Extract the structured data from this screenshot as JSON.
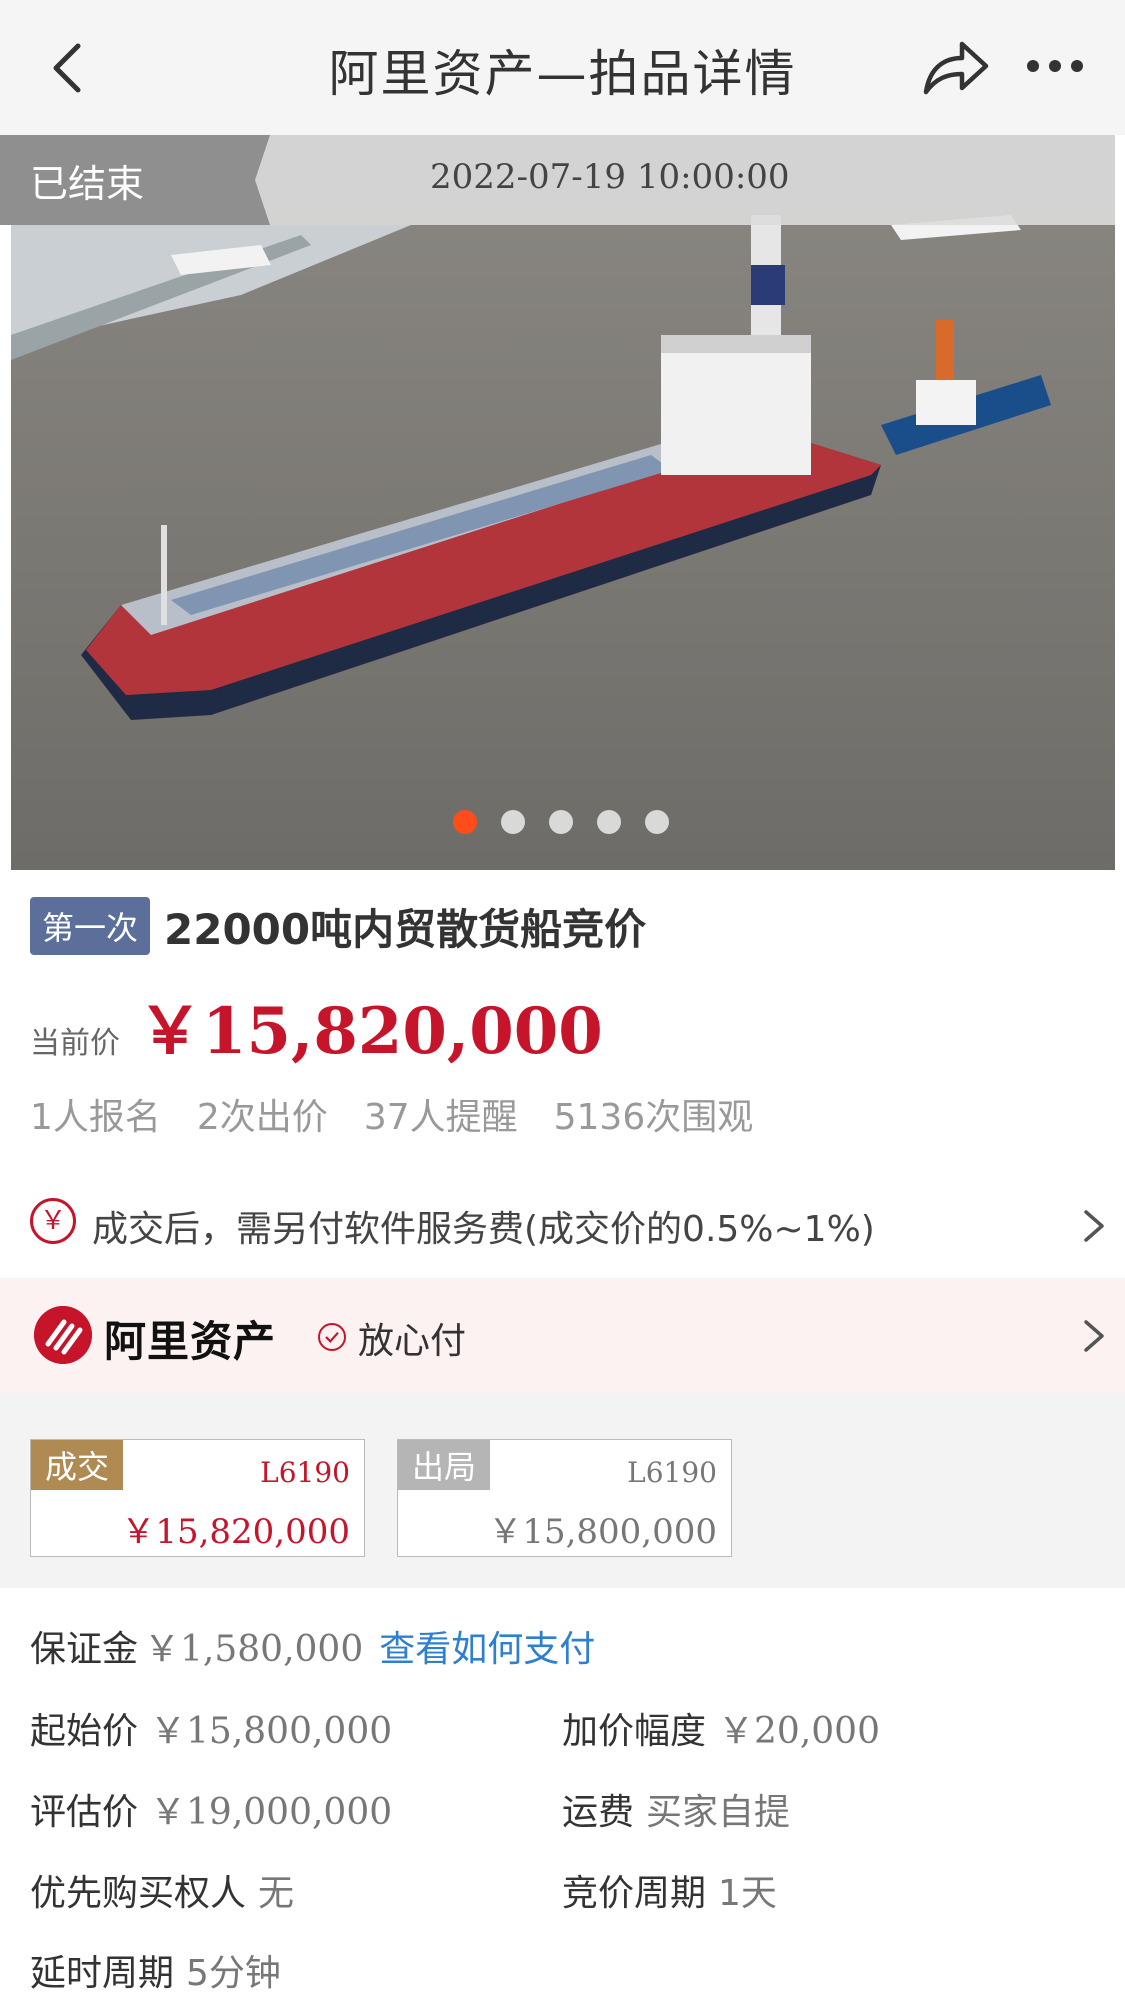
{
  "header": {
    "title": "阿里资产—拍品详情"
  },
  "hero": {
    "status": "已结束",
    "time": "2022-07-19 10:00:00",
    "slide_count": 5,
    "active_slide": 1
  },
  "item": {
    "round_badge": "第一次",
    "title": "22000吨内贸散货船竞价",
    "price_label": "当前价",
    "price": "￥15,820,000",
    "stats": [
      "1人报名",
      "2次出价",
      "37人提醒",
      "5136次围观"
    ]
  },
  "fee_notice": {
    "icon_char": "￥",
    "text": "成交后，需另付软件服务费(成交价的0.5%~1%)"
  },
  "brand": {
    "name": "阿里资产",
    "assurance": "放心付"
  },
  "bids": [
    {
      "status": "成交",
      "code": "L6190",
      "price": "￥15,820,000"
    },
    {
      "status": "出局",
      "code": "L6190",
      "price": "￥15,800,000"
    }
  ],
  "details": {
    "deposit_label": "保证金",
    "deposit_value": "￥1,580,000",
    "deposit_link": "查看如何支付",
    "start_label": "起始价",
    "start_value": "￥15,800,000",
    "increment_label": "加价幅度",
    "increment_value": "￥20,000",
    "appraisal_label": "评估价",
    "appraisal_value": "￥19,000,000",
    "shipping_label": "运费",
    "shipping_value": "买家自提",
    "preempt_label": "优先购买权人",
    "preempt_value": "无",
    "cycle_label": "竞价周期",
    "cycle_value": "1天",
    "delay_label": "延时周期",
    "delay_value": "5分钟"
  },
  "colors": {
    "accent_red": "#c6142b",
    "link_blue": "#2f7fd1",
    "badge_blue": "#5b6f9a",
    "win_gold": "#b08a53"
  }
}
